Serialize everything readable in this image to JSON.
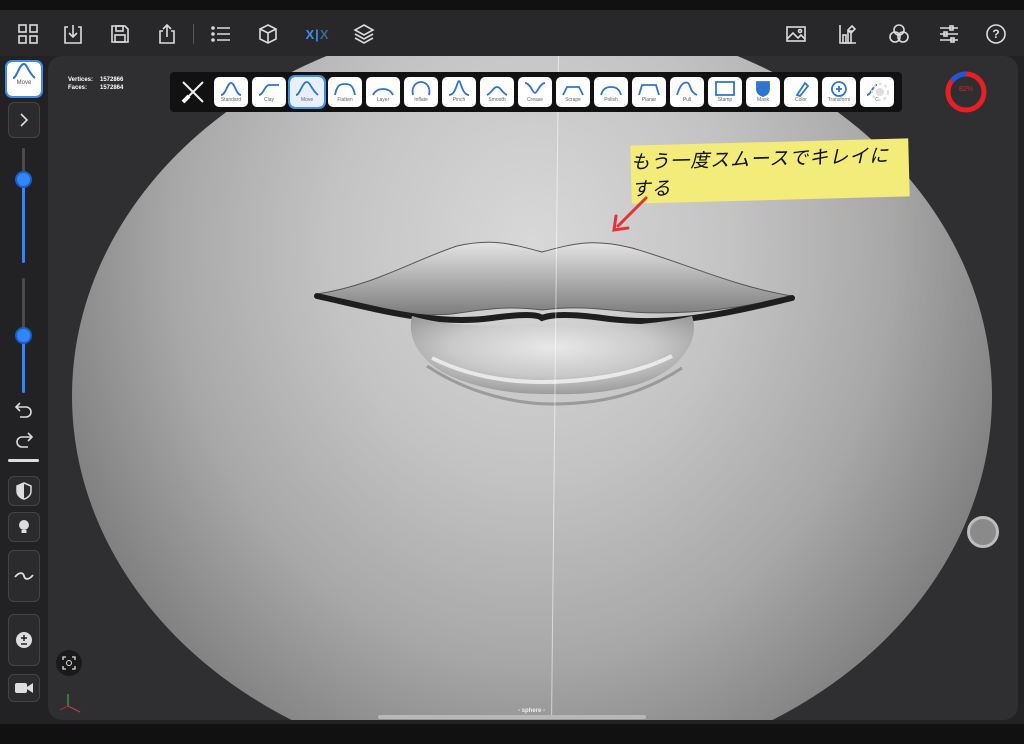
{
  "topbar": {
    "left_icons": [
      "grid-icon",
      "import-icon",
      "save-icon",
      "share-icon",
      "list-icon",
      "cube-icon",
      "symmetry-icon",
      "layers-icon"
    ],
    "right_icons": [
      "image-icon",
      "paint-icon",
      "material-icon",
      "settings-icon",
      "help-icon"
    ],
    "symmetry_label_left": "X",
    "symmetry_label_right": "X",
    "help_label": "?"
  },
  "stats": {
    "vertices_label": "Vertices:",
    "vertices_value": "1572866",
    "faces_label": "Faces:",
    "faces_value": "1572864"
  },
  "brushes": [
    {
      "label": "Standard"
    },
    {
      "label": "Clay"
    },
    {
      "label": "Move",
      "active": true
    },
    {
      "label": "Flatten"
    },
    {
      "label": "Layer"
    },
    {
      "label": "Inflate"
    },
    {
      "label": "Pinch"
    },
    {
      "label": "Smooth"
    },
    {
      "label": "Crease"
    },
    {
      "label": "Scrape"
    },
    {
      "label": "Polish"
    },
    {
      "label": "Planar"
    },
    {
      "label": "Pull"
    },
    {
      "label": "Stamp"
    },
    {
      "label": "Mask"
    },
    {
      "label": "Color"
    },
    {
      "label": "Transform"
    },
    {
      "label": "C"
    }
  ],
  "current_tool": {
    "label": "Move"
  },
  "annotation": {
    "text": "もう一度スムースでキレイにする"
  },
  "performance": {
    "value": "82%"
  },
  "object": {
    "name": "- sphere -"
  },
  "left_tools": {
    "radius_slider": 0.28,
    "intensity_slider": 0.5
  },
  "colors": {
    "accent": "#2f86ff",
    "annotation_bg": "#f4ec7a",
    "arrow": "#e2323a"
  }
}
